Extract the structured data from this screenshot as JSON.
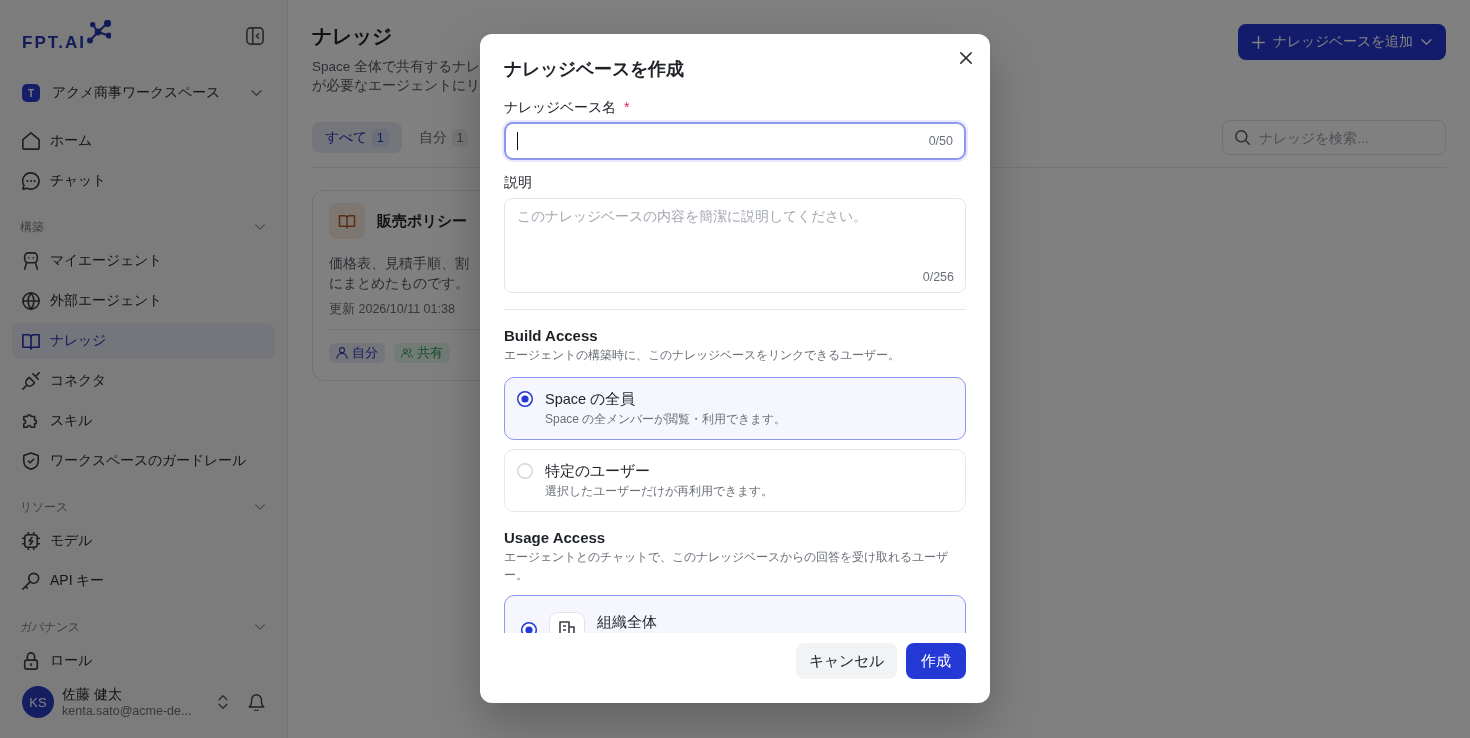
{
  "sidebar": {
    "logo": {
      "text": "FPT.AI"
    },
    "workspace": {
      "initial": "T",
      "name": "アクメ商事ワークスペース"
    },
    "sections": [
      {
        "items": [
          {
            "label": "ホーム",
            "selected": false
          },
          {
            "label": "チャット",
            "selected": false
          }
        ]
      },
      {
        "title": "構築",
        "expanded": true,
        "items": [
          {
            "label": "マイエージェント",
            "selected": false
          },
          {
            "label": "外部エージェント",
            "selected": false
          },
          {
            "label": "ナレッジ",
            "selected": true
          },
          {
            "label": "コネクタ",
            "selected": false
          },
          {
            "label": "スキル",
            "selected": false
          },
          {
            "label": "ワークスペースのガードレール",
            "selected": false
          }
        ]
      },
      {
        "title": "リソース",
        "expanded": true,
        "items": [
          {
            "label": "モデル",
            "selected": false
          },
          {
            "label": "API キー",
            "selected": false
          }
        ]
      },
      {
        "title": "ガバナンス",
        "expanded": true,
        "items": [
          {
            "label": "ロール",
            "selected": false
          }
        ]
      }
    ],
    "user": {
      "initials": "KS",
      "name": "佐藤 健太",
      "email": "kenta.sato@acme-de..."
    }
  },
  "main": {
    "title": "ナレッジ",
    "description_lines": [
      "Space 全体で共有するナレ",
      "が必要なエージェントにリ"
    ],
    "add_button": {
      "label": "ナレッジベースを追加"
    },
    "tabs": [
      {
        "label": "すべて",
        "count": "1",
        "selected": true
      },
      {
        "label": "自分",
        "count": "1",
        "selected": false
      }
    ],
    "search": {
      "placeholder": "ナレッジを検索..."
    },
    "cards": [
      {
        "title": "販売ポリシー",
        "description_lines": [
          "価格表、見積手順、割",
          "にまとめたものです。"
        ],
        "updated": "更新 2026/10/11 01:38",
        "tags": [
          {
            "kind": "owner",
            "label": "自分"
          },
          {
            "kind": "shared",
            "label": "共有"
          }
        ]
      }
    ]
  },
  "modal": {
    "title": "ナレッジベースを作成",
    "name_field": {
      "label": "ナレッジベース名",
      "required_mark": "*",
      "counter": "0/50",
      "focused": true
    },
    "description_field": {
      "label": "説明",
      "placeholder": "このナレッジベースの内容を簡潔に説明してください。",
      "counter": "0/256"
    },
    "build_access": {
      "heading": "Build Access",
      "description": "エージェントの構築時に、このナレッジベースをリンクできるユーザー。",
      "options": [
        {
          "title": "Space の全員",
          "description": "Space の全メンバーが閲覧・利用できます。",
          "selected": true
        },
        {
          "title": "特定のユーザー",
          "description": "選択したユーザーだけが再利用できます。",
          "selected": false
        }
      ]
    },
    "usage_access": {
      "heading": "Usage Access",
      "description": "エージェントとのチャットで、このナレッジベースからの回答を受け取れるユーザー。",
      "options": [
        {
          "title": "組織全体",
          "selected": true
        }
      ]
    },
    "buttons": [
      {
        "kind": "secondary",
        "label": "キャンセル"
      },
      {
        "kind": "primary",
        "label": "作成"
      }
    ]
  }
}
